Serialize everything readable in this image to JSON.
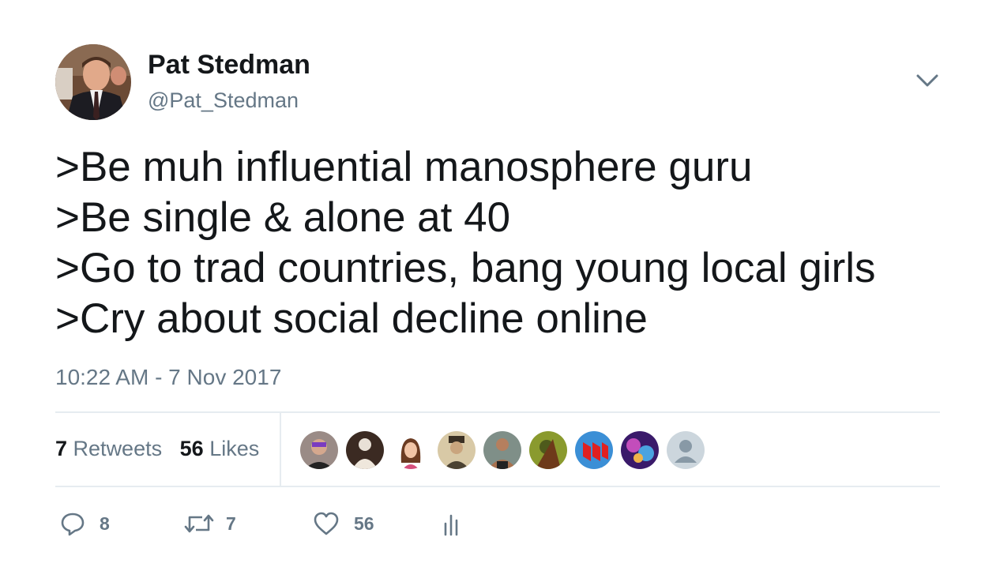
{
  "author": {
    "name": "Pat Stedman",
    "handle": "@Pat_Stedman"
  },
  "tweet": {
    "lines": [
      ">Be muh influential manosphere guru",
      ">Be single & alone at 40",
      ">Go to trad countries, bang young local girls",
      ">Cry about social decline online"
    ],
    "timestamp": "10:22 AM - 7 Nov 2017"
  },
  "stats": {
    "retweets_count": "7",
    "retweets_label": "Retweets",
    "likes_count": "56",
    "likes_label": "Likes"
  },
  "actions": {
    "reply_count": "8",
    "retweet_count": "7",
    "like_count": "56"
  },
  "colors": {
    "text": "#14171a",
    "secondary": "#657786",
    "divider": "#e6ecf0"
  }
}
